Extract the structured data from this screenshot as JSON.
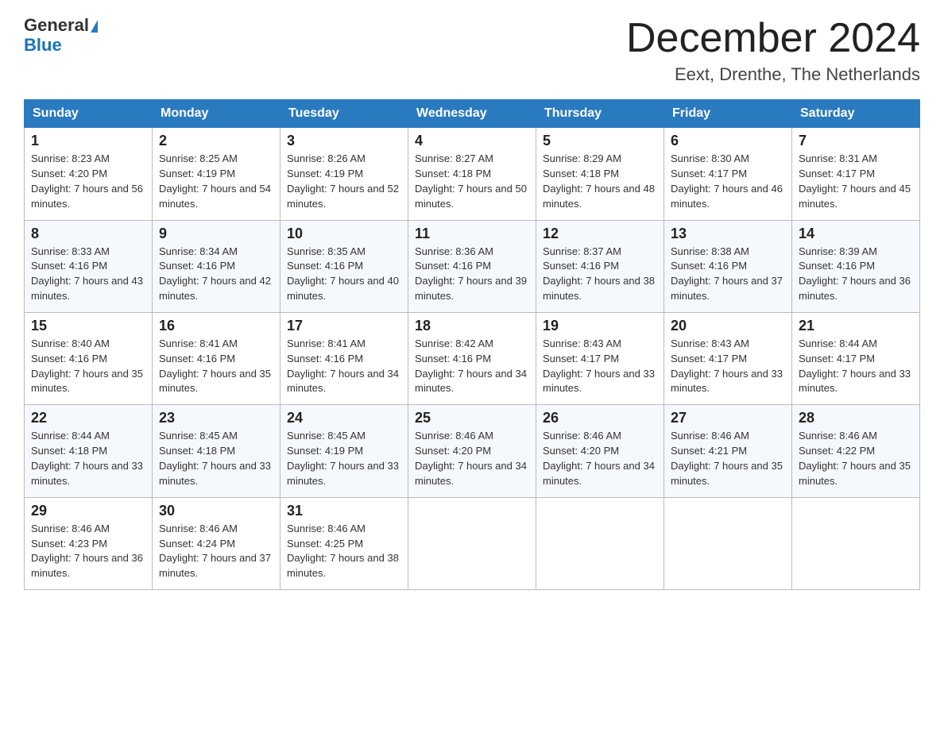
{
  "header": {
    "logo_line1": "General",
    "logo_line2": "Blue",
    "month_title": "December 2024",
    "location": "Eext, Drenthe, The Netherlands"
  },
  "weekdays": [
    "Sunday",
    "Monday",
    "Tuesday",
    "Wednesday",
    "Thursday",
    "Friday",
    "Saturday"
  ],
  "weeks": [
    [
      {
        "day": "1",
        "sunrise": "Sunrise: 8:23 AM",
        "sunset": "Sunset: 4:20 PM",
        "daylight": "Daylight: 7 hours and 56 minutes."
      },
      {
        "day": "2",
        "sunrise": "Sunrise: 8:25 AM",
        "sunset": "Sunset: 4:19 PM",
        "daylight": "Daylight: 7 hours and 54 minutes."
      },
      {
        "day": "3",
        "sunrise": "Sunrise: 8:26 AM",
        "sunset": "Sunset: 4:19 PM",
        "daylight": "Daylight: 7 hours and 52 minutes."
      },
      {
        "day": "4",
        "sunrise": "Sunrise: 8:27 AM",
        "sunset": "Sunset: 4:18 PM",
        "daylight": "Daylight: 7 hours and 50 minutes."
      },
      {
        "day": "5",
        "sunrise": "Sunrise: 8:29 AM",
        "sunset": "Sunset: 4:18 PM",
        "daylight": "Daylight: 7 hours and 48 minutes."
      },
      {
        "day": "6",
        "sunrise": "Sunrise: 8:30 AM",
        "sunset": "Sunset: 4:17 PM",
        "daylight": "Daylight: 7 hours and 46 minutes."
      },
      {
        "day": "7",
        "sunrise": "Sunrise: 8:31 AM",
        "sunset": "Sunset: 4:17 PM",
        "daylight": "Daylight: 7 hours and 45 minutes."
      }
    ],
    [
      {
        "day": "8",
        "sunrise": "Sunrise: 8:33 AM",
        "sunset": "Sunset: 4:16 PM",
        "daylight": "Daylight: 7 hours and 43 minutes."
      },
      {
        "day": "9",
        "sunrise": "Sunrise: 8:34 AM",
        "sunset": "Sunset: 4:16 PM",
        "daylight": "Daylight: 7 hours and 42 minutes."
      },
      {
        "day": "10",
        "sunrise": "Sunrise: 8:35 AM",
        "sunset": "Sunset: 4:16 PM",
        "daylight": "Daylight: 7 hours and 40 minutes."
      },
      {
        "day": "11",
        "sunrise": "Sunrise: 8:36 AM",
        "sunset": "Sunset: 4:16 PM",
        "daylight": "Daylight: 7 hours and 39 minutes."
      },
      {
        "day": "12",
        "sunrise": "Sunrise: 8:37 AM",
        "sunset": "Sunset: 4:16 PM",
        "daylight": "Daylight: 7 hours and 38 minutes."
      },
      {
        "day": "13",
        "sunrise": "Sunrise: 8:38 AM",
        "sunset": "Sunset: 4:16 PM",
        "daylight": "Daylight: 7 hours and 37 minutes."
      },
      {
        "day": "14",
        "sunrise": "Sunrise: 8:39 AM",
        "sunset": "Sunset: 4:16 PM",
        "daylight": "Daylight: 7 hours and 36 minutes."
      }
    ],
    [
      {
        "day": "15",
        "sunrise": "Sunrise: 8:40 AM",
        "sunset": "Sunset: 4:16 PM",
        "daylight": "Daylight: 7 hours and 35 minutes."
      },
      {
        "day": "16",
        "sunrise": "Sunrise: 8:41 AM",
        "sunset": "Sunset: 4:16 PM",
        "daylight": "Daylight: 7 hours and 35 minutes."
      },
      {
        "day": "17",
        "sunrise": "Sunrise: 8:41 AM",
        "sunset": "Sunset: 4:16 PM",
        "daylight": "Daylight: 7 hours and 34 minutes."
      },
      {
        "day": "18",
        "sunrise": "Sunrise: 8:42 AM",
        "sunset": "Sunset: 4:16 PM",
        "daylight": "Daylight: 7 hours and 34 minutes."
      },
      {
        "day": "19",
        "sunrise": "Sunrise: 8:43 AM",
        "sunset": "Sunset: 4:17 PM",
        "daylight": "Daylight: 7 hours and 33 minutes."
      },
      {
        "day": "20",
        "sunrise": "Sunrise: 8:43 AM",
        "sunset": "Sunset: 4:17 PM",
        "daylight": "Daylight: 7 hours and 33 minutes."
      },
      {
        "day": "21",
        "sunrise": "Sunrise: 8:44 AM",
        "sunset": "Sunset: 4:17 PM",
        "daylight": "Daylight: 7 hours and 33 minutes."
      }
    ],
    [
      {
        "day": "22",
        "sunrise": "Sunrise: 8:44 AM",
        "sunset": "Sunset: 4:18 PM",
        "daylight": "Daylight: 7 hours and 33 minutes."
      },
      {
        "day": "23",
        "sunrise": "Sunrise: 8:45 AM",
        "sunset": "Sunset: 4:18 PM",
        "daylight": "Daylight: 7 hours and 33 minutes."
      },
      {
        "day": "24",
        "sunrise": "Sunrise: 8:45 AM",
        "sunset": "Sunset: 4:19 PM",
        "daylight": "Daylight: 7 hours and 33 minutes."
      },
      {
        "day": "25",
        "sunrise": "Sunrise: 8:46 AM",
        "sunset": "Sunset: 4:20 PM",
        "daylight": "Daylight: 7 hours and 34 minutes."
      },
      {
        "day": "26",
        "sunrise": "Sunrise: 8:46 AM",
        "sunset": "Sunset: 4:20 PM",
        "daylight": "Daylight: 7 hours and 34 minutes."
      },
      {
        "day": "27",
        "sunrise": "Sunrise: 8:46 AM",
        "sunset": "Sunset: 4:21 PM",
        "daylight": "Daylight: 7 hours and 35 minutes."
      },
      {
        "day": "28",
        "sunrise": "Sunrise: 8:46 AM",
        "sunset": "Sunset: 4:22 PM",
        "daylight": "Daylight: 7 hours and 35 minutes."
      }
    ],
    [
      {
        "day": "29",
        "sunrise": "Sunrise: 8:46 AM",
        "sunset": "Sunset: 4:23 PM",
        "daylight": "Daylight: 7 hours and 36 minutes."
      },
      {
        "day": "30",
        "sunrise": "Sunrise: 8:46 AM",
        "sunset": "Sunset: 4:24 PM",
        "daylight": "Daylight: 7 hours and 37 minutes."
      },
      {
        "day": "31",
        "sunrise": "Sunrise: 8:46 AM",
        "sunset": "Sunset: 4:25 PM",
        "daylight": "Daylight: 7 hours and 38 minutes."
      },
      null,
      null,
      null,
      null
    ]
  ]
}
